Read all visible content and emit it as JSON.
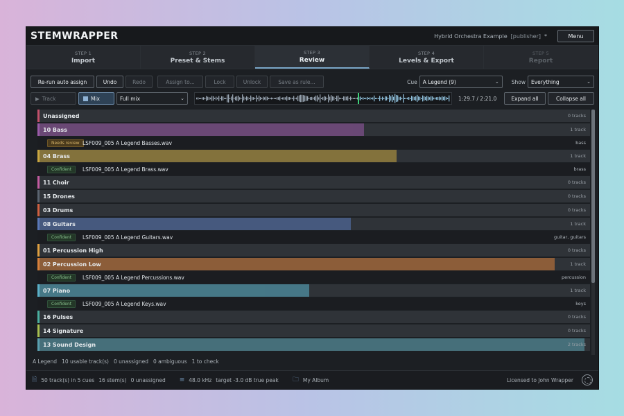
{
  "app": {
    "logo": "STEMWRAPPER",
    "project": "Hybrid Orchestra Example",
    "role": "[publisher]",
    "modified": "*",
    "menu": "Menu"
  },
  "steps": [
    {
      "num": "STEP 1",
      "name": "Import",
      "state": "normal"
    },
    {
      "num": "STEP 2",
      "name": "Preset & Stems",
      "state": "normal"
    },
    {
      "num": "STEP 3",
      "name": "Review",
      "state": "active"
    },
    {
      "num": "STEP 4",
      "name": "Levels & Export",
      "state": "normal"
    },
    {
      "num": "STEP 5",
      "name": "Report",
      "state": "disabled"
    }
  ],
  "toolbar": {
    "rerun": "Re-run auto assign",
    "undo": "Undo",
    "redo": "Redo",
    "assign": "Assign to...",
    "lock": "Lock",
    "unlock": "Unlock",
    "save_rule": "Save as rule...",
    "cue_label": "Cue",
    "cue_value": "A Legend  (9)",
    "show_label": "Show",
    "show_value": "Everything"
  },
  "toolbar2": {
    "track": "Track",
    "mix": "Mix",
    "mix_select": "Full mix",
    "time": "1:29.7 / 2:21.0",
    "expand": "Expand all",
    "collapse": "Collapse all",
    "playhead_fraction": 0.636
  },
  "groups": [
    {
      "name": "Unassigned",
      "count": "0 tracks",
      "color": "#c2506a",
      "fill": 0,
      "expanded": false
    },
    {
      "name": "10  Bass",
      "count": "1 track",
      "color": "#9a5aa8",
      "fill": 0.59,
      "expanded": true,
      "file": {
        "badge": "Needs review",
        "status": "review",
        "name": "LSF009_005 A Legend Basses.wav",
        "tag": "bass"
      }
    },
    {
      "name": "04  Brass",
      "count": "1 track",
      "color": "#c9a640",
      "fill": 0.649,
      "expanded": true,
      "file": {
        "badge": "Confident",
        "status": "ok",
        "name": "LSF009_005 A Legend Brass.wav",
        "tag": "brass"
      }
    },
    {
      "name": "11  Choir",
      "count": "0 tracks",
      "color": "#c25aa0",
      "fill": 0,
      "expanded": false
    },
    {
      "name": "15  Drones",
      "count": "0 tracks",
      "color": "#5a6470",
      "fill": 0,
      "expanded": false
    },
    {
      "name": "03  Drums",
      "count": "0 tracks",
      "color": "#d06040",
      "fill": 0,
      "expanded": false
    },
    {
      "name": "08  Guitars",
      "count": "1 track",
      "color": "#5a78b8",
      "fill": 0.566,
      "expanded": true,
      "file": {
        "badge": "Confident",
        "status": "ok",
        "name": "LSF009_005 A Legend Guitars.wav",
        "tag": "guitar, guitars"
      }
    },
    {
      "name": "01  Percussion High",
      "count": "0 tracks",
      "color": "#e0a040",
      "fill": 0,
      "expanded": false
    },
    {
      "name": "02  Percussion Low",
      "count": "1 track",
      "color": "#d8803a",
      "fill": 0.936,
      "expanded": true,
      "file": {
        "badge": "Confident",
        "status": "ok",
        "name": "LSF009_005 A Legend Percussions.wav",
        "tag": "percussion"
      }
    },
    {
      "name": "07  Piano",
      "count": "1 track",
      "color": "#5ab0c8",
      "fill": 0.49,
      "expanded": true,
      "file": {
        "badge": "Confident",
        "status": "ok",
        "name": "LSF009_005 A Legend Keys.wav",
        "tag": "keys"
      }
    },
    {
      "name": "16  Pulses",
      "count": "0 tracks",
      "color": "#4ab0a0",
      "fill": 0,
      "expanded": false
    },
    {
      "name": "14  Signature",
      "count": "0 tracks",
      "color": "#a8c050",
      "fill": 0,
      "expanded": false
    },
    {
      "name": "13  Sound Design",
      "count": "2 tracks",
      "color": "#5aa0b0",
      "fill": 0.99,
      "expanded": true
    }
  ],
  "summary": {
    "cue": "A Legend",
    "usable": "10 usable track(s)",
    "unassigned": "0 unassigned",
    "ambiguous": "0 ambiguous",
    "check": "1 to check"
  },
  "status": {
    "tracks": "50 track(s) in 5 cues",
    "stems": "16 stem(s)",
    "unassigned": "0 unassigned",
    "rate": "48.0 kHz",
    "target": "target -3.0 dB true peak",
    "album": "My Album",
    "license": "Licensed to John Wrapper"
  }
}
